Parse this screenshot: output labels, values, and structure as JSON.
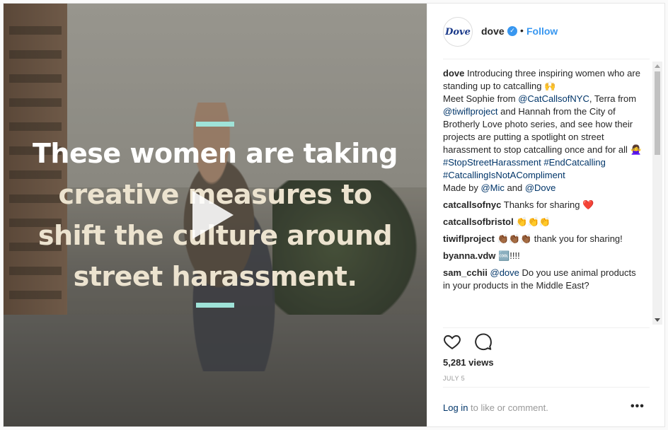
{
  "media": {
    "headline": [
      {
        "text": "These women are taking",
        "style": "white"
      },
      {
        "text": "creative measures to",
        "style": "cream"
      },
      {
        "text": "shift the culture around",
        "style": "cream"
      },
      {
        "text": "street harassment.",
        "style": "cream"
      }
    ],
    "accent_color": "#9fe3d8",
    "play_icon": "play-icon"
  },
  "header": {
    "avatar_text": "Dove",
    "username": "dove",
    "verified_icon": "verified-badge-icon",
    "separator": "•",
    "follow_label": "Follow"
  },
  "caption": {
    "user": "dove",
    "lines": [
      "Introducing three inspiring women who are standing up to catcalling 🙌",
      "Meet Sophie from ",
      "@CatCallsofNYC",
      ", Terra from ",
      "@tiwiflproject",
      " and Hannah from the City of Brotherly Love photo series, and see how their projects are putting a spotlight on street harassment to stop catcalling once and for all 🙅‍♀️",
      "#StopStreetHarassment",
      " ",
      "#EndCatcalling",
      "#CatcallingIsNotACompliment",
      "Made by ",
      "@Mic",
      " and ",
      "@Dove"
    ]
  },
  "comments": [
    {
      "user": "catcallsofnyc",
      "text": "Thanks for sharing ❤️"
    },
    {
      "user": "catcallsofbristol",
      "text": "👏👏👏"
    },
    {
      "user": "tiwiflproject",
      "text": "👏🏾👏🏾👏🏾 thank you for sharing!"
    },
    {
      "user": "byanna.vdw",
      "text": "🆒!!!!"
    },
    {
      "user": "sam_cchii",
      "mention": "@dove",
      "text": " Do you use animal products in your products in the Middle East?"
    }
  ],
  "actions": {
    "like_icon": "heart-icon",
    "comment_icon": "comment-bubble-icon",
    "views": "5,281 views",
    "date": "JULY 5"
  },
  "footer": {
    "login_link": "Log in",
    "login_rest": " to like or comment.",
    "more_label": "•••"
  }
}
